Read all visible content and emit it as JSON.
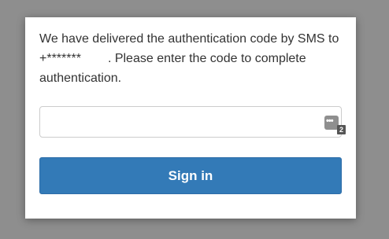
{
  "dialog": {
    "message_prefix": "We have delivered the authentication code by SMS to +*******",
    "message_suffix": ". Please enter the code to complete authentication."
  },
  "code_input": {
    "value": "",
    "placeholder": ""
  },
  "password_manager": {
    "icon": "password-manager-dots-icon",
    "dots": "•••",
    "badge_count": "2"
  },
  "actions": {
    "sign_in_label": "Sign in"
  },
  "colors": {
    "backdrop": "#8e8e8e",
    "dialog_bg": "#ffffff",
    "text": "#333333",
    "primary_button": "#337ab7",
    "input_border": "#cccccc"
  }
}
